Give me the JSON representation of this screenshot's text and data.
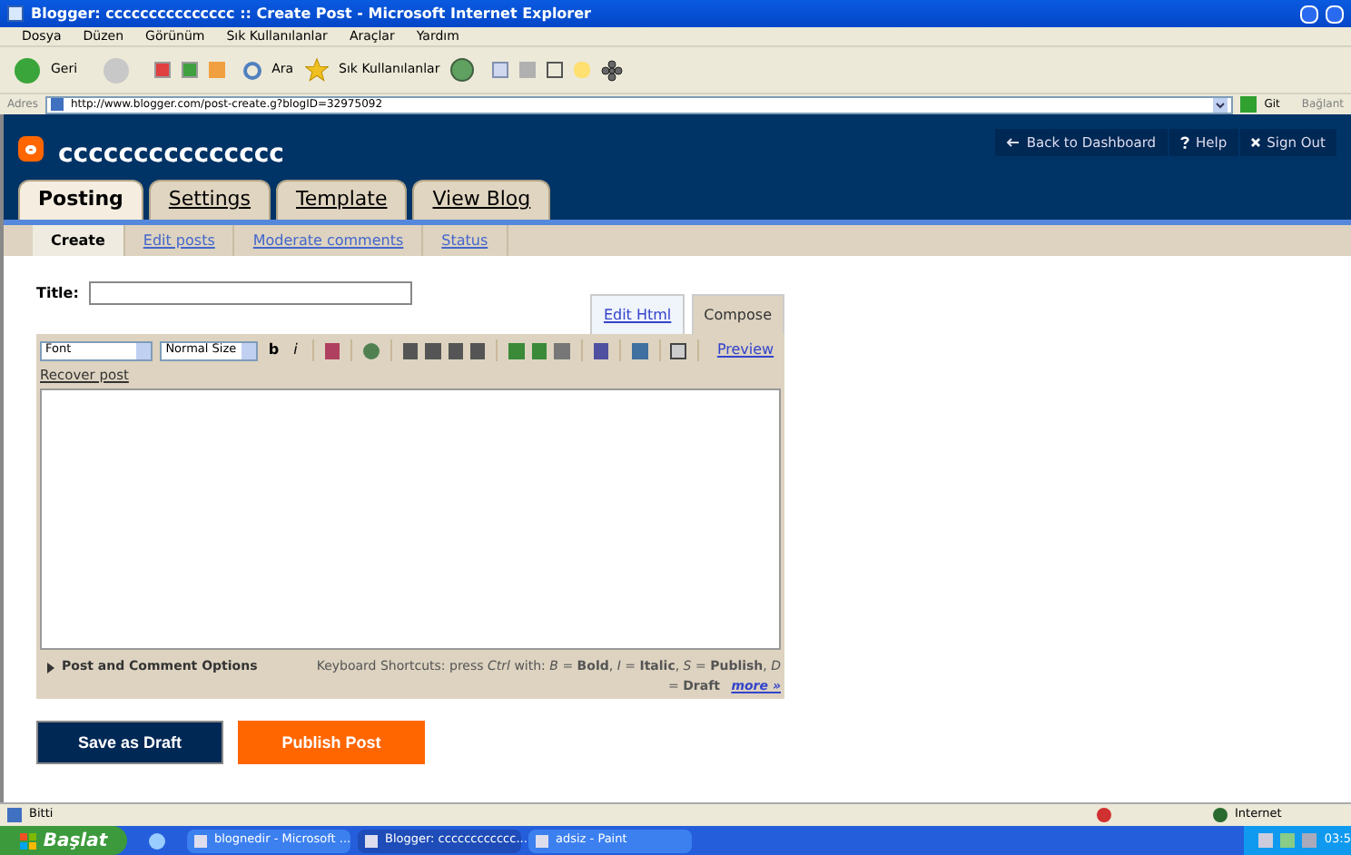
{
  "window": {
    "title": "Blogger: ccccccccccccccc :: Create Post - Microsoft Internet Explorer"
  },
  "menu": [
    "Dosya",
    "Düzen",
    "Görünüm",
    "Sık Kullanılanlar",
    "Araçlar",
    "Yardım"
  ],
  "toolbar": {
    "back": "Geri",
    "search": "Ara",
    "favorites": "Sık Kullanılanlar"
  },
  "address": {
    "label": "Adres",
    "value": "http://www.blogger.com/post-create.g?blogID=32975092",
    "go": "Git",
    "links": "Bağlant"
  },
  "blog": {
    "name": "ccccccccccccccc",
    "nav": [
      {
        "kind": "back",
        "label": "Back to Dashboard"
      },
      {
        "kind": "help",
        "label": "Help"
      },
      {
        "kind": "close",
        "label": "Sign Out"
      }
    ]
  },
  "tabs": [
    {
      "label": "Posting",
      "selected": true
    },
    {
      "label": "Settings",
      "selected": false
    },
    {
      "label": "Template",
      "selected": false
    },
    {
      "label": "View Blog",
      "selected": false
    }
  ],
  "subtabs": [
    {
      "label": "Create",
      "selected": true
    },
    {
      "label": "Edit posts",
      "selected": false
    },
    {
      "label": "Moderate comments",
      "selected": false
    },
    {
      "label": "Status",
      "selected": false
    }
  ],
  "title_field": {
    "label": "Title:"
  },
  "editor_tabs": [
    {
      "label": "Edit Html",
      "selected": false
    },
    {
      "label": "Compose",
      "selected": true
    }
  ],
  "editor": {
    "font": "Font",
    "size": "Normal Size",
    "bold": "b",
    "italic": "i",
    "preview": "Preview",
    "recover": "Recover post",
    "options": "Post and Comment Options",
    "shortcuts": "Keyboard Shortcuts: press *Ctrl* with: *B* = **Bold**, *I* = **Italic**, *S* = **Publish**, *D* = **Draft**",
    "more": "more »"
  },
  "buttons": [
    {
      "kind": "draft",
      "label": "Save as Draft"
    },
    {
      "kind": "publish",
      "label": "Publish Post"
    }
  ],
  "status_bar": {
    "text": "Bitti",
    "zone": "Internet"
  },
  "taskbar": {
    "start": "Başlat",
    "items": [
      {
        "label": "blognedir - Microsoft ...",
        "selected": false
      },
      {
        "label": "Blogger: cccccccccccc...",
        "selected": true
      },
      {
        "label": "adsiz - Paint",
        "selected": false
      }
    ],
    "clock": "03:5"
  }
}
